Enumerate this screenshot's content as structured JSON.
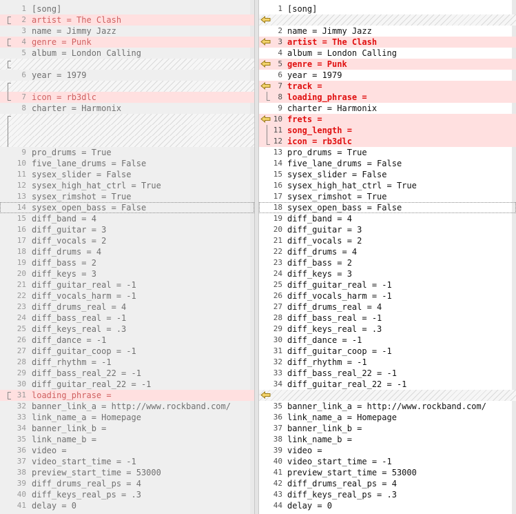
{
  "left": {
    "rows": [
      {
        "n": "1",
        "t": "[song]",
        "k": ""
      },
      {
        "n": "2",
        "t": "artist = The Clash",
        "k": "diff",
        "g": "single"
      },
      {
        "n": "3",
        "t": "name = Jimmy Jazz",
        "k": ""
      },
      {
        "n": "4",
        "t": "genre = Punk",
        "k": "diff",
        "g": "single"
      },
      {
        "n": "5",
        "t": "album = London Calling",
        "k": ""
      },
      {
        "n": "",
        "t": "",
        "k": "gap",
        "g": "single"
      },
      {
        "n": "6",
        "t": "year = 1979",
        "k": ""
      },
      {
        "n": "",
        "t": "",
        "k": "gap",
        "g": "top"
      },
      {
        "n": "7",
        "t": "icon = rb3dlc",
        "k": "diff",
        "g": "bot"
      },
      {
        "n": "8",
        "t": "charter = Harmonix",
        "k": ""
      },
      {
        "n": "",
        "t": "",
        "k": "gap",
        "g": "top"
      },
      {
        "n": "",
        "t": "",
        "k": "gap",
        "g": "mid"
      },
      {
        "n": "",
        "t": "",
        "k": "gap",
        "g": "mid"
      },
      {
        "n": "9",
        "t": "pro_drums = True",
        "k": ""
      },
      {
        "n": "10",
        "t": "five_lane_drums = False",
        "k": ""
      },
      {
        "n": "11",
        "t": "sysex_slider = False",
        "k": ""
      },
      {
        "n": "12",
        "t": "sysex_high_hat_ctrl = True",
        "k": ""
      },
      {
        "n": "13",
        "t": "sysex_rimshot = True",
        "k": ""
      },
      {
        "n": "14",
        "t": "sysex_open_bass = False",
        "k": "boxed"
      },
      {
        "n": "15",
        "t": "diff_band = 4",
        "k": ""
      },
      {
        "n": "16",
        "t": "diff_guitar = 3",
        "k": ""
      },
      {
        "n": "17",
        "t": "diff_vocals = 2",
        "k": ""
      },
      {
        "n": "18",
        "t": "diff_drums = 4",
        "k": ""
      },
      {
        "n": "19",
        "t": "diff_bass = 2",
        "k": ""
      },
      {
        "n": "20",
        "t": "diff_keys = 3",
        "k": ""
      },
      {
        "n": "21",
        "t": "diff_guitar_real = -1",
        "k": ""
      },
      {
        "n": "22",
        "t": "diff_vocals_harm = -1",
        "k": ""
      },
      {
        "n": "23",
        "t": "diff_drums_real = 4",
        "k": ""
      },
      {
        "n": "24",
        "t": "diff_bass_real = -1",
        "k": ""
      },
      {
        "n": "25",
        "t": "diff_keys_real = .3",
        "k": ""
      },
      {
        "n": "26",
        "t": "diff_dance = -1",
        "k": ""
      },
      {
        "n": "27",
        "t": "diff_guitar_coop = -1",
        "k": ""
      },
      {
        "n": "28",
        "t": "diff_rhythm = -1",
        "k": ""
      },
      {
        "n": "29",
        "t": "diff_bass_real_22 = -1",
        "k": ""
      },
      {
        "n": "30",
        "t": "diff_guitar_real_22 = -1",
        "k": ""
      },
      {
        "n": "31",
        "t": "loading_phrase =",
        "k": "diff",
        "g": "single"
      },
      {
        "n": "32",
        "t": "banner_link_a = http://www.rockband.com/",
        "k": ""
      },
      {
        "n": "33",
        "t": "link_name_a = Homepage",
        "k": ""
      },
      {
        "n": "34",
        "t": "banner_link_b =",
        "k": ""
      },
      {
        "n": "35",
        "t": "link_name_b =",
        "k": ""
      },
      {
        "n": "36",
        "t": "video =",
        "k": ""
      },
      {
        "n": "37",
        "t": "video_start_time = -1",
        "k": ""
      },
      {
        "n": "38",
        "t": "preview_start_time = 53000",
        "k": ""
      },
      {
        "n": "39",
        "t": "diff_drums_real_ps = 4",
        "k": ""
      },
      {
        "n": "40",
        "t": "diff_keys_real_ps = .3",
        "k": ""
      },
      {
        "n": "41",
        "t": "delay = 0",
        "k": ""
      }
    ]
  },
  "right": {
    "rows": [
      {
        "n": "1",
        "t": "[song]",
        "k": ""
      },
      {
        "n": "",
        "t": "",
        "k": "gap",
        "a": true
      },
      {
        "n": "2",
        "t": "name = Jimmy Jazz",
        "k": ""
      },
      {
        "n": "3",
        "t": "artist = The Clash",
        "k": "diff",
        "a": true
      },
      {
        "n": "4",
        "t": "album = London Calling",
        "k": ""
      },
      {
        "n": "5",
        "t": "genre = Punk",
        "k": "diff",
        "a": true
      },
      {
        "n": "6",
        "t": "year = 1979",
        "k": ""
      },
      {
        "n": "7",
        "t": "track =",
        "k": "diff",
        "a": true
      },
      {
        "n": "8",
        "t": "loading_phrase =",
        "k": "diff",
        "g": "bot"
      },
      {
        "n": "9",
        "t": "charter = Harmonix",
        "k": ""
      },
      {
        "n": "10",
        "t": "frets =",
        "k": "diff",
        "a": true
      },
      {
        "n": "11",
        "t": "song_length =",
        "k": "diff",
        "g": "mid"
      },
      {
        "n": "12",
        "t": "icon = rb3dlc",
        "k": "diff",
        "g": "bot"
      },
      {
        "n": "13",
        "t": "pro_drums = True",
        "k": ""
      },
      {
        "n": "14",
        "t": "five_lane_drums = False",
        "k": ""
      },
      {
        "n": "15",
        "t": "sysex_slider = False",
        "k": ""
      },
      {
        "n": "16",
        "t": "sysex_high_hat_ctrl = True",
        "k": ""
      },
      {
        "n": "17",
        "t": "sysex_rimshot = True",
        "k": ""
      },
      {
        "n": "18",
        "t": "sysex_open_bass = False",
        "k": "boxed"
      },
      {
        "n": "19",
        "t": "diff_band = 4",
        "k": ""
      },
      {
        "n": "20",
        "t": "diff_guitar = 3",
        "k": ""
      },
      {
        "n": "21",
        "t": "diff_vocals = 2",
        "k": ""
      },
      {
        "n": "22",
        "t": "diff_drums = 4",
        "k": ""
      },
      {
        "n": "23",
        "t": "diff_bass = 2",
        "k": ""
      },
      {
        "n": "24",
        "t": "diff_keys = 3",
        "k": ""
      },
      {
        "n": "25",
        "t": "diff_guitar_real = -1",
        "k": ""
      },
      {
        "n": "26",
        "t": "diff_vocals_harm = -1",
        "k": ""
      },
      {
        "n": "27",
        "t": "diff_drums_real = 4",
        "k": ""
      },
      {
        "n": "28",
        "t": "diff_bass_real = -1",
        "k": ""
      },
      {
        "n": "29",
        "t": "diff_keys_real = .3",
        "k": ""
      },
      {
        "n": "30",
        "t": "diff_dance = -1",
        "k": ""
      },
      {
        "n": "31",
        "t": "diff_guitar_coop = -1",
        "k": ""
      },
      {
        "n": "32",
        "t": "diff_rhythm = -1",
        "k": ""
      },
      {
        "n": "33",
        "t": "diff_bass_real_22 = -1",
        "k": ""
      },
      {
        "n": "34",
        "t": "diff_guitar_real_22 = -1",
        "k": ""
      },
      {
        "n": "",
        "t": "",
        "k": "gap",
        "a": true
      },
      {
        "n": "35",
        "t": "banner_link_a = http://www.rockband.com/",
        "k": ""
      },
      {
        "n": "36",
        "t": "link_name_a = Homepage",
        "k": ""
      },
      {
        "n": "37",
        "t": "banner_link_b =",
        "k": ""
      },
      {
        "n": "38",
        "t": "link_name_b =",
        "k": ""
      },
      {
        "n": "39",
        "t": "video =",
        "k": ""
      },
      {
        "n": "40",
        "t": "video_start_time = -1",
        "k": ""
      },
      {
        "n": "41",
        "t": "preview_start_time = 53000",
        "k": ""
      },
      {
        "n": "42",
        "t": "diff_drums_real_ps = 4",
        "k": ""
      },
      {
        "n": "43",
        "t": "diff_keys_real_ps = .3",
        "k": ""
      },
      {
        "n": "44",
        "t": "delay = 0",
        "k": ""
      }
    ]
  },
  "icons": {
    "copy_arrow": "copy-to-left-arrow-icon",
    "change_bracket": "change-bracket-icon"
  },
  "colors": {
    "diff_bg": "#ffe0e0",
    "diff_text_right": "#e01010",
    "diff_text_left": "#d06060",
    "arrow_fill": "#f3d36b",
    "arrow_stroke": "#9a7a16",
    "left_bg": "#efefef",
    "right_bg": "#ffffff"
  }
}
